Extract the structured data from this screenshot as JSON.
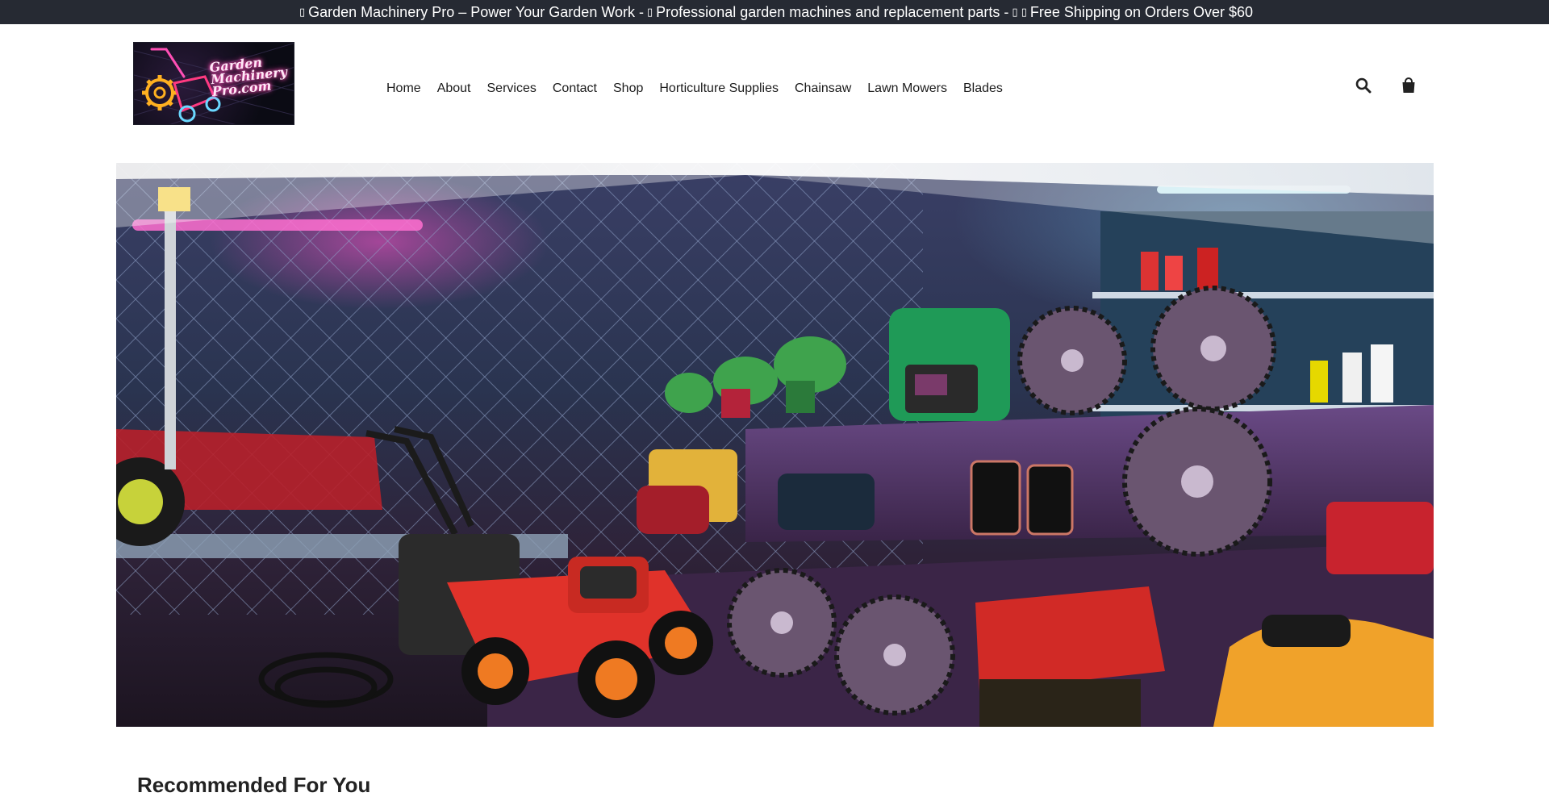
{
  "announcement": {
    "segments": [
      "Garden Machinery Pro – Power Your Garden Work -",
      "Professional garden machines and replacement parts -",
      "Free Shipping on Orders Over $60"
    ],
    "glyphs": [
      "▯",
      "▯",
      "▯ ▯"
    ]
  },
  "logo": {
    "text": "Garden Machinery Pro.com",
    "icon": "lawn-mower-gear-neon-logo"
  },
  "nav": {
    "items": [
      "Home",
      "About",
      "Services",
      "Contact",
      "Shop",
      "Horticulture Supplies",
      "Chainsaw",
      "Lawn Mowers",
      "Blades"
    ]
  },
  "header_icons": {
    "search": "search-icon",
    "cart": "shopping-bag-icon"
  },
  "hero": {
    "image": "garden-machinery-workshop-banner"
  },
  "recommended": {
    "title": "Recommended For You"
  },
  "colors": {
    "topbar_bg": "#262a33",
    "topbar_text": "#ffffff",
    "nav_text": "#1c1c1c",
    "neon_pink": "#ff4fb5",
    "mower_red": "#e0322a"
  }
}
